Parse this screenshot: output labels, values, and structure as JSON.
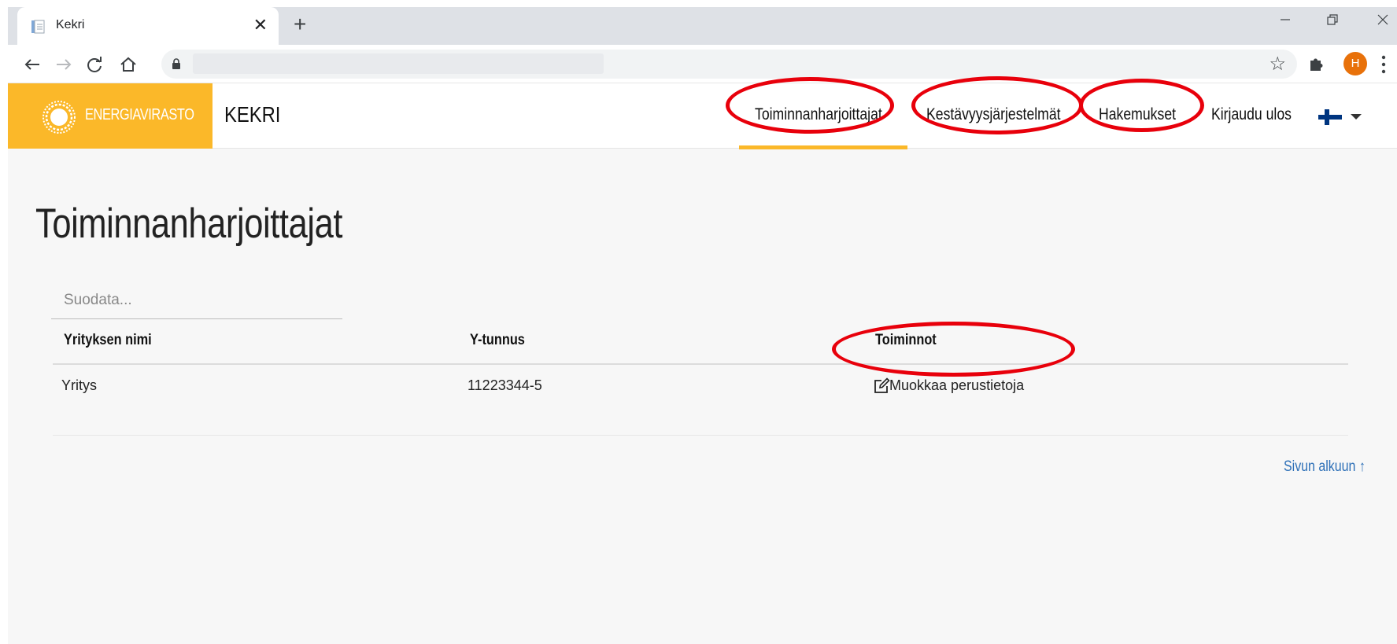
{
  "browser": {
    "tab_title": "Kekri",
    "tab_close": "✕",
    "new_tab": "+",
    "profile_initial": "H"
  },
  "header": {
    "logo_text": "ENERGIAVIRASTO",
    "app_name": "KEKRI",
    "nav": [
      {
        "label": "Toiminnanharjoittajat",
        "active": true
      },
      {
        "label": "Kestävyysjärjestelmät",
        "active": false
      },
      {
        "label": "Hakemukset",
        "active": false
      },
      {
        "label": "Kirjaudu ulos",
        "active": false
      }
    ],
    "language": "fi"
  },
  "main": {
    "title": "Toiminnanharjoittajat",
    "filter": {
      "placeholder": "Suodata...",
      "value": ""
    },
    "table": {
      "headers": [
        "Yrityksen nimi",
        "Y-tunnus",
        "Toiminnot"
      ],
      "rows": [
        {
          "name": "Yritys",
          "business_id": "11223344-5",
          "action": "Muokkaa perustietoja"
        }
      ]
    },
    "back_to_top": "Sivun alkuun ↑"
  },
  "colors": {
    "brand_yellow": "#fbb829",
    "link_blue": "#2c6fb7",
    "annotation_red": "#e8000b"
  }
}
